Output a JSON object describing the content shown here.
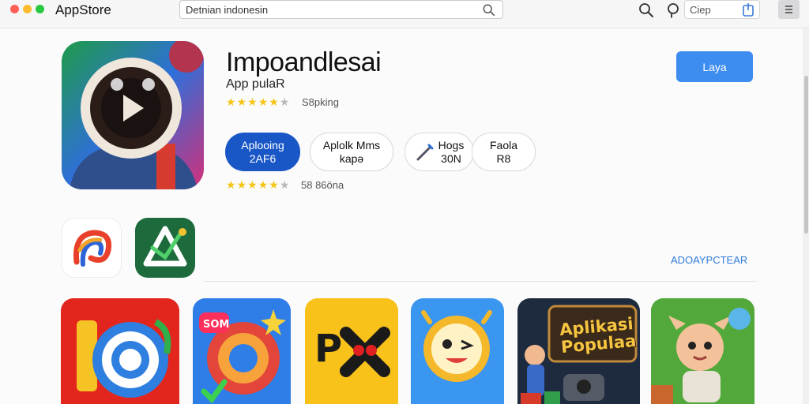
{
  "titlebar": {
    "app_title": "AppStore",
    "search_value": "Detnian indonesin",
    "field_text": "Ciep"
  },
  "hero": {
    "app_name": "Impoandlesai",
    "subtitle": "App pulaR",
    "rating_1": {
      "stars": 4.5,
      "text": "S8pking"
    },
    "rating_2": {
      "stars": 4.5,
      "text": "58 86öna"
    },
    "get_button": "Laya",
    "pills": {
      "primary": {
        "line1": "Aplooing",
        "line2": "2AF6"
      },
      "a": {
        "line1": "Aplolk Mms",
        "line2": "kapə"
      },
      "b": {
        "line1": "Hogs",
        "line2": "30N"
      },
      "c": {
        "line1": "Faola",
        "line2": "R8"
      }
    }
  },
  "section": {
    "see_all": "ADOAYPCTEAR"
  },
  "grid": {
    "poster_title_1": "Aplikasi",
    "poster_title_2": "Populaa"
  },
  "colors": {
    "accent": "#3d8df0",
    "primary_pill": "#1a57c6",
    "link": "#2f7bd8",
    "star": "#f5c518"
  },
  "icons": [
    "search-icon",
    "user-icon",
    "share-icon",
    "menu-icon"
  ]
}
